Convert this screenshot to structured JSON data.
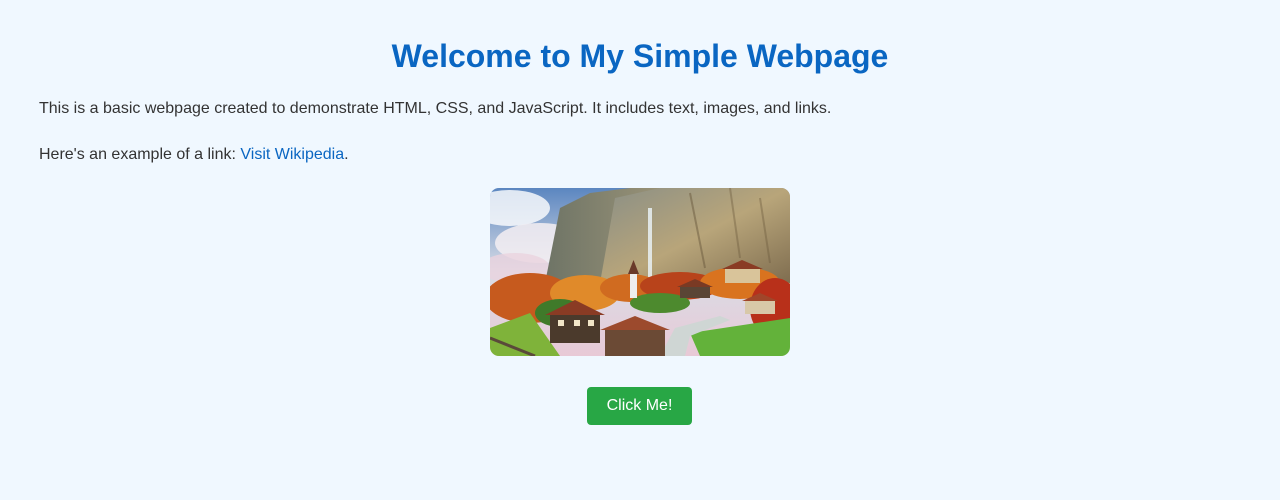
{
  "page": {
    "heading": "Welcome to My Simple Webpage",
    "intro": "This is a basic webpage created to demonstrate HTML, CSS, and JavaScript. It includes text, images, and links.",
    "link_prefix": "Here's an example of a link: ",
    "link_text": "Visit Wikipedia",
    "link_suffix": ".",
    "image_alt": "Mountain village scene",
    "button_label": "Click Me!"
  },
  "colors": {
    "background": "#f0f8ff",
    "heading": "#0a66c2",
    "link": "#0a66c2",
    "button": "#28a745",
    "text": "#333333"
  }
}
